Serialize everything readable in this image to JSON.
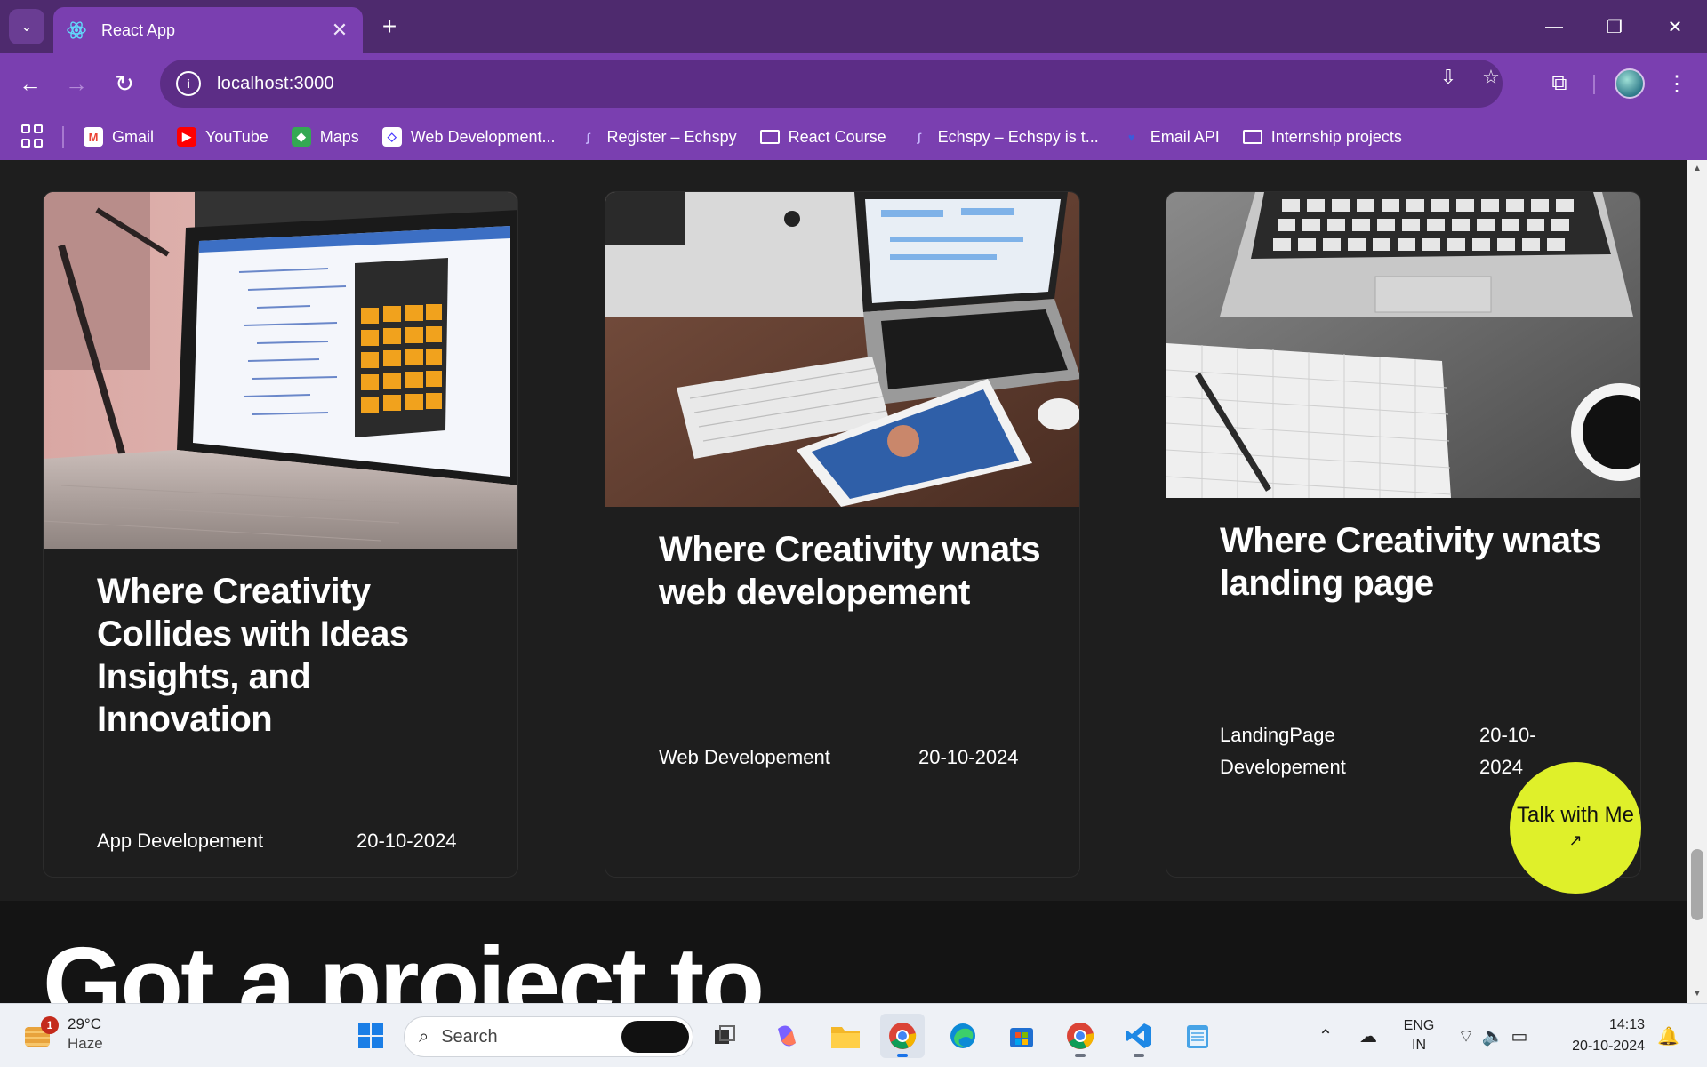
{
  "browser": {
    "tab_title": "React App",
    "url": "localhost:3000",
    "bookmarks": [
      {
        "label": "Gmail",
        "icon": "gmail-icon",
        "color": "#ea4335"
      },
      {
        "label": "YouTube",
        "icon": "youtube-icon",
        "color": "#ff0000"
      },
      {
        "label": "Maps",
        "icon": "maps-icon",
        "color": "#34a853"
      },
      {
        "label": "Web Development...",
        "icon": "web-dev-icon",
        "color": "#4a3aff"
      },
      {
        "label": "Register – Echspy",
        "icon": "echspy-icon",
        "color": "#6a5acd"
      },
      {
        "label": "React Course",
        "icon": "folder-icon",
        "color": "#ffffff"
      },
      {
        "label": "Echspy – Echspy is t...",
        "icon": "echspy-icon",
        "color": "#6a5acd"
      },
      {
        "label": "Email API",
        "icon": "email-api-icon",
        "color": "#3b5bdb"
      },
      {
        "label": "Internship projects",
        "icon": "folder-icon",
        "color": "#ffffff"
      }
    ]
  },
  "cards": [
    {
      "title": "Where Creativity Collides with Ideas Insights, and Innovation",
      "category": "App Developement",
      "date": "20-10-2024"
    },
    {
      "title": "Where Creativity wnats web developement",
      "category": "Web Developement",
      "date": "20-10-2024"
    },
    {
      "title": "Where Creativity wnats landing page",
      "category": "LandingPage Developement",
      "date": "20-10-2024"
    }
  ],
  "cta": {
    "title": "Got a project to",
    "button_label": "Talk with Me",
    "button_arrow": "↗"
  },
  "taskbar": {
    "weather_temp": "29°C",
    "weather_desc": "Haze",
    "weather_badge": "1",
    "search_placeholder": "Search",
    "lang_top": "ENG",
    "lang_bottom": "IN",
    "time": "14:13",
    "date": "20-10-2024"
  },
  "colors": {
    "tab_strip": "#4e2a6e",
    "toolbar": "#7a3fb0",
    "page_bg": "#1e1e1e",
    "cta_button": "#dff02a"
  }
}
